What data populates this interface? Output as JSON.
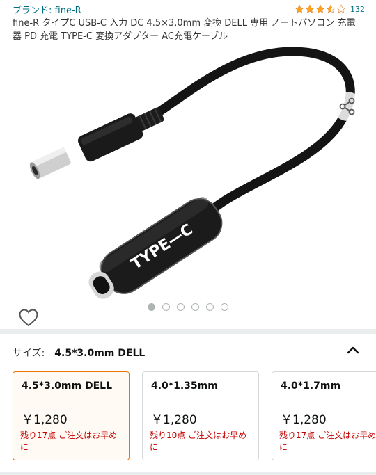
{
  "header": {
    "brand_link": "ブランド: fine-R",
    "rating_value": 3.5,
    "rating_count": "132"
  },
  "product": {
    "title": "fine-R タイプC USB-C 入力 DC 4.5×3.0mm 変換 DELL 専用 ノートパソコン 充電器 PD 充電 TYPE-C 変換アダプター AC充電ケーブル",
    "image_label": "TYPE—C",
    "image_count": 6,
    "active_image_index": 0
  },
  "icons": {
    "share": "share-icon",
    "favorite": "heart-icon",
    "collapse": "chevron-up-icon"
  },
  "size_selector": {
    "label": "サイズ:",
    "selected_value": "4.5*3.0mm DELL",
    "options": [
      {
        "name": "4.5*3.0mm DELL",
        "price": "￥1,280",
        "stock": "残り17点 ご注文はお早めに",
        "selected": true
      },
      {
        "name": "4.0*1.35mm",
        "price": "￥1,280",
        "stock": "残り10点 ご注文はお早めに",
        "selected": false
      },
      {
        "name": "4.0*1.7mm",
        "price": "￥1,280",
        "stock": "残り17点 ご注文はお早めに",
        "selected": false
      }
    ]
  },
  "colors": {
    "link": "#007185",
    "star": "#ffa41c",
    "stock_warning": "#c40000",
    "selected_border": "#e77600"
  }
}
